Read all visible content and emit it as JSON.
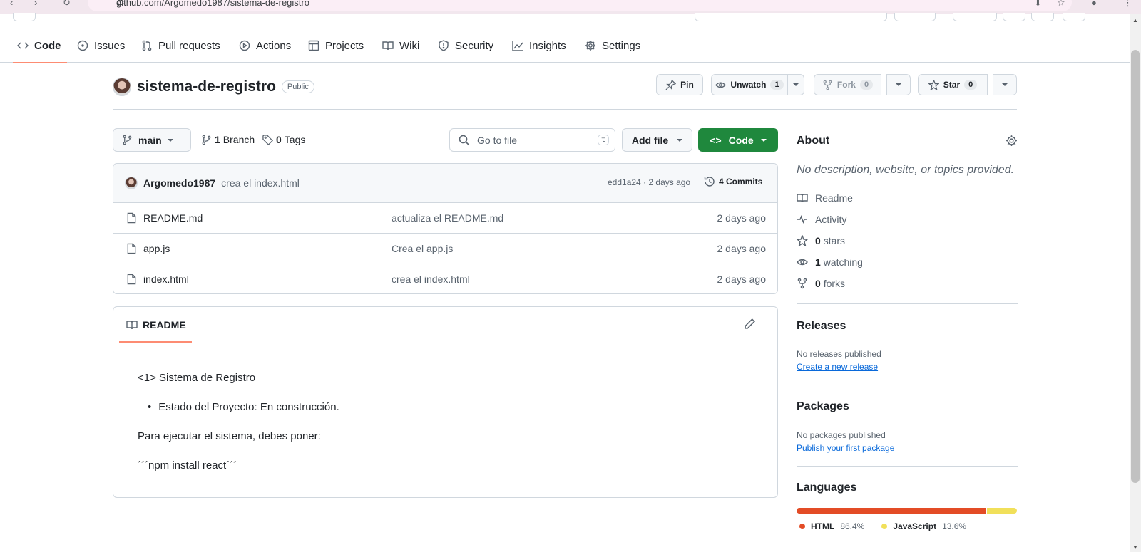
{
  "browser": {
    "url": "github.com/Argomedo1987/sistema-de-registro"
  },
  "nav_tabs": [
    {
      "label": "Code",
      "icon": "code-icon",
      "active": true
    },
    {
      "label": "Issues",
      "icon": "issue-opened-icon"
    },
    {
      "label": "Pull requests",
      "icon": "git-pull-request-icon"
    },
    {
      "label": "Actions",
      "icon": "play-icon"
    },
    {
      "label": "Projects",
      "icon": "table-icon"
    },
    {
      "label": "Wiki",
      "icon": "book-icon"
    },
    {
      "label": "Security",
      "icon": "shield-icon"
    },
    {
      "label": "Insights",
      "icon": "graph-icon"
    },
    {
      "label": "Settings",
      "icon": "gear-icon"
    }
  ],
  "repo": {
    "name": "sistema-de-registro",
    "visibility": "Public",
    "pin_label": "Pin",
    "unwatch_label": "Unwatch",
    "watch_count": "1",
    "fork_label": "Fork",
    "fork_count": "0",
    "star_label": "Star",
    "star_count": "0"
  },
  "toolbar": {
    "branch": "main",
    "branch_count": "1",
    "branch_label": "Branch",
    "tag_count": "0",
    "tag_label": "Tags",
    "go_to_file_placeholder": "Go to file",
    "go_to_file_shortcut": "t",
    "add_file_label": "Add file",
    "code_label": "Code"
  },
  "latest_commit": {
    "author": "Argomedo1987",
    "message": "crea el index.html",
    "hash_time": "edd1a24 · 2 days ago",
    "commits_label": "4 Commits"
  },
  "files": [
    {
      "name": "README.md",
      "message": "actualiza el README.md",
      "date": "2 days ago"
    },
    {
      "name": "app.js",
      "message": "Crea el app.js",
      "date": "2 days ago"
    },
    {
      "name": "index.html",
      "message": "crea el index.html",
      "date": "2 days ago"
    }
  ],
  "readme": {
    "tab_label": "README",
    "heading": "<1> Sistema de Registro",
    "bullet": "Estado del Proyecto: En construcción.",
    "para": "Para ejecutar el sistema, debes poner:",
    "code": "´´´npm install react´´´"
  },
  "about": {
    "title": "About",
    "description": "No description, website, or topics provided.",
    "readme_label": "Readme",
    "activity_label": "Activity",
    "stars_count": "0",
    "stars_label": "stars",
    "watching_count": "1",
    "watching_label": "watching",
    "forks_count": "0",
    "forks_label": "forks"
  },
  "releases": {
    "title": "Releases",
    "empty_text": "No releases published",
    "link": "Create a new release"
  },
  "packages": {
    "title": "Packages",
    "empty_text": "No packages published",
    "link": "Publish your first package"
  },
  "languages": {
    "title": "Languages",
    "items": [
      {
        "name": "HTML",
        "percent": "86.4%",
        "value": 86.4,
        "color": "#e34c26"
      },
      {
        "name": "JavaScript",
        "percent": "13.6%",
        "value": 13.6,
        "color": "#f1e05a"
      }
    ]
  },
  "colors": {
    "primary_green": "#1f883d",
    "link_blue": "#0969da",
    "active_tab_underline": "#fd8c73"
  }
}
